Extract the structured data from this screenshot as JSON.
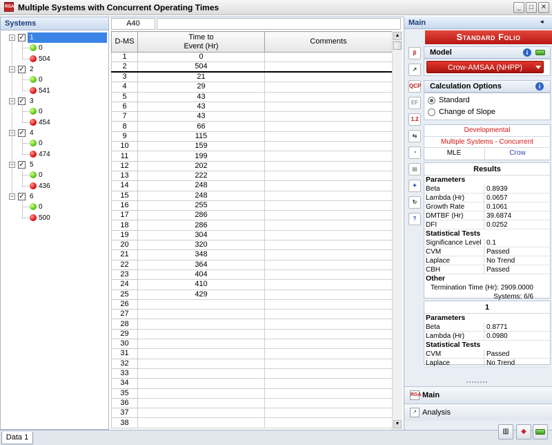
{
  "window": {
    "title": "Multiple Systems with Concurrent Operating Times",
    "app_icon": "RGA",
    "minimize": "_",
    "maximize": "□",
    "close": "✕"
  },
  "systems_panel": {
    "title": "Systems",
    "systems": [
      {
        "label": "1",
        "start": "0",
        "end": "504",
        "selected": true
      },
      {
        "label": "2",
        "start": "0",
        "end": "541"
      },
      {
        "label": "3",
        "start": "0",
        "end": "454"
      },
      {
        "label": "4",
        "start": "0",
        "end": "474"
      },
      {
        "label": "5",
        "start": "0",
        "end": "436"
      },
      {
        "label": "6",
        "start": "0",
        "end": "500"
      }
    ]
  },
  "grid": {
    "cell_ref": "A40",
    "formula": "",
    "col_rownum": "D-MS",
    "col_time_line1": "Time to",
    "col_time_line2": "Event (Hr)",
    "col_comments": "Comments",
    "rows": [
      [
        "1",
        "0"
      ],
      [
        "2",
        "504"
      ],
      [
        "3",
        "21"
      ],
      [
        "4",
        "29"
      ],
      [
        "5",
        "43"
      ],
      [
        "6",
        "43"
      ],
      [
        "7",
        "43"
      ],
      [
        "8",
        "66"
      ],
      [
        "9",
        "115"
      ],
      [
        "10",
        "159"
      ],
      [
        "11",
        "199"
      ],
      [
        "12",
        "202"
      ],
      [
        "13",
        "222"
      ],
      [
        "14",
        "248"
      ],
      [
        "15",
        "248"
      ],
      [
        "16",
        "255"
      ],
      [
        "17",
        "286"
      ],
      [
        "18",
        "286"
      ],
      [
        "19",
        "304"
      ],
      [
        "20",
        "320"
      ],
      [
        "21",
        "348"
      ],
      [
        "22",
        "364"
      ],
      [
        "23",
        "404"
      ],
      [
        "24",
        "410"
      ],
      [
        "25",
        "429"
      ],
      [
        "26",
        ""
      ],
      [
        "27",
        ""
      ],
      [
        "28",
        ""
      ],
      [
        "29",
        ""
      ],
      [
        "30",
        ""
      ],
      [
        "31",
        ""
      ],
      [
        "32",
        ""
      ],
      [
        "33",
        ""
      ],
      [
        "34",
        ""
      ],
      [
        "35",
        ""
      ],
      [
        "36",
        ""
      ],
      [
        "37",
        ""
      ],
      [
        "38",
        ""
      ]
    ]
  },
  "main_panel": {
    "header": "Main",
    "folio_title": "Standard Folio",
    "model_label": "Model",
    "model_value": "Crow-AMSAA (NHPP)",
    "calc_label": "Calculation Options",
    "calc_options": [
      "Standard",
      "Change of Slope"
    ],
    "calc_selected": 0,
    "developmental": "Developmental",
    "data_type": "Multiple Systems - Concurrent",
    "method": "MLE",
    "bounds": "Crow",
    "results_title": "Results",
    "results": {
      "parameters_label": "Parameters",
      "parameters": [
        {
          "k": "Beta",
          "v": "0.8939"
        },
        {
          "k": "Lambda (Hr)",
          "v": "0.0657"
        },
        {
          "k": "Growth Rate",
          "v": "0.1061"
        },
        {
          "k": "DMTBF (Hr)",
          "v": "39.6874"
        },
        {
          "k": "DFI",
          "v": "0.0252"
        }
      ],
      "stat_tests_label": "Statistical Tests",
      "stat_tests": [
        {
          "k": "Significance Level",
          "v": "0.1"
        },
        {
          "k": "CVM",
          "v": "Passed"
        },
        {
          "k": "Laplace",
          "v": "No Trend"
        },
        {
          "k": "CBH",
          "v": "Passed"
        }
      ],
      "other_label": "Other",
      "termination": "Termination Time (Hr): 2909.0000",
      "systems_count": "Systems: 6/6"
    },
    "system_result": {
      "title": "1",
      "parameters_label": "Parameters",
      "parameters": [
        {
          "k": "Beta",
          "v": "0.8771"
        },
        {
          "k": "Lambda (Hr)",
          "v": "0.0980"
        }
      ],
      "stat_tests_label": "Statistical Tests",
      "stat_tests": [
        {
          "k": "CVM",
          "v": "Passed"
        },
        {
          "k": "Laplace",
          "v": "No Trend"
        }
      ]
    },
    "nav_main": "Main",
    "nav_analysis": "Analysis"
  },
  "status": {
    "sheet_tab": "Data 1"
  }
}
